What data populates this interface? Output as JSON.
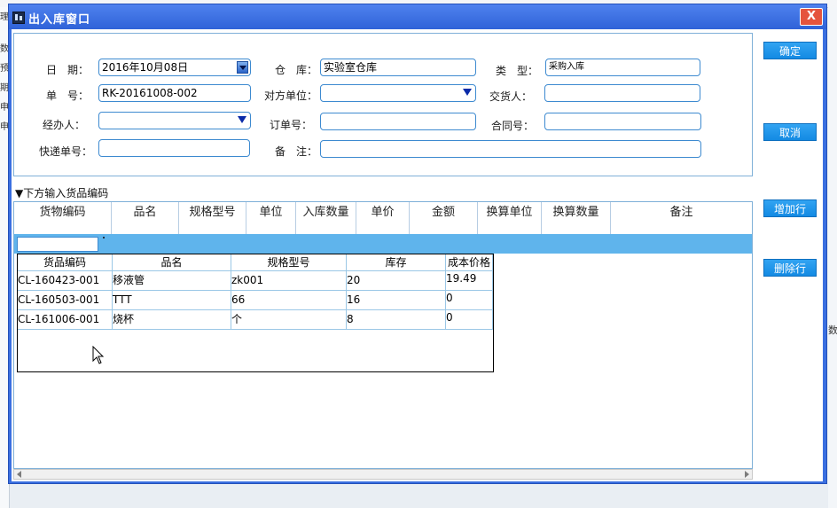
{
  "background": {
    "left_glyphs": [
      "理",
      "数",
      "预",
      "期",
      "申",
      "申"
    ],
    "right_glyphs": [
      "数"
    ]
  },
  "window": {
    "title": "出入库窗口",
    "close_label": "X"
  },
  "form": {
    "date_label": "日　期：",
    "date_value": "2016年10月08日",
    "warehouse_label": "仓　库：",
    "warehouse_value": "实验室仓库",
    "type_label": "类　型：",
    "type_value": "采购入库",
    "order_no_label": "单　号：",
    "order_no_value": "RK-20161008-002",
    "counterparty_label": "对方单位：",
    "counterparty_value": "",
    "deliverer_label": "交货人：",
    "deliverer_value": "",
    "handler_label": "经办人：",
    "handler_value": "",
    "purchase_order_label": "订单号：",
    "purchase_order_value": "",
    "contract_label": "合同号：",
    "contract_value": "",
    "courier_label": "快递单号：",
    "courier_value": "",
    "remark_label": "备　注：",
    "remark_value": ""
  },
  "buttons": {
    "confirm": "确定",
    "cancel": "取消",
    "add_row": "增加行",
    "delete_row": "删除行"
  },
  "section_title": "▼下方输入货品编码",
  "grid": {
    "columns": [
      "货物编码",
      "品名",
      "规格型号",
      "单位",
      "入库数量",
      "单价",
      "金额",
      "换算单位",
      "换算数量",
      "备注"
    ]
  },
  "popup": {
    "columns": [
      "货品编码",
      "品名",
      "规格型号",
      "库存",
      "成本价格"
    ],
    "rows": [
      [
        "CL-160423-001",
        "移液管",
        "zk001",
        "20",
        "19.49"
      ],
      [
        "CL-160503-001",
        "TTT",
        "66",
        "16",
        "0"
      ],
      [
        "CL-161006-001",
        "烧杯",
        "个",
        "8",
        "0"
      ]
    ]
  },
  "colors": {
    "title_bar": "#3a6fe0",
    "button": "#1f95e8",
    "selected_row": "#5fb4ec",
    "field_border": "#3d8ad0"
  }
}
